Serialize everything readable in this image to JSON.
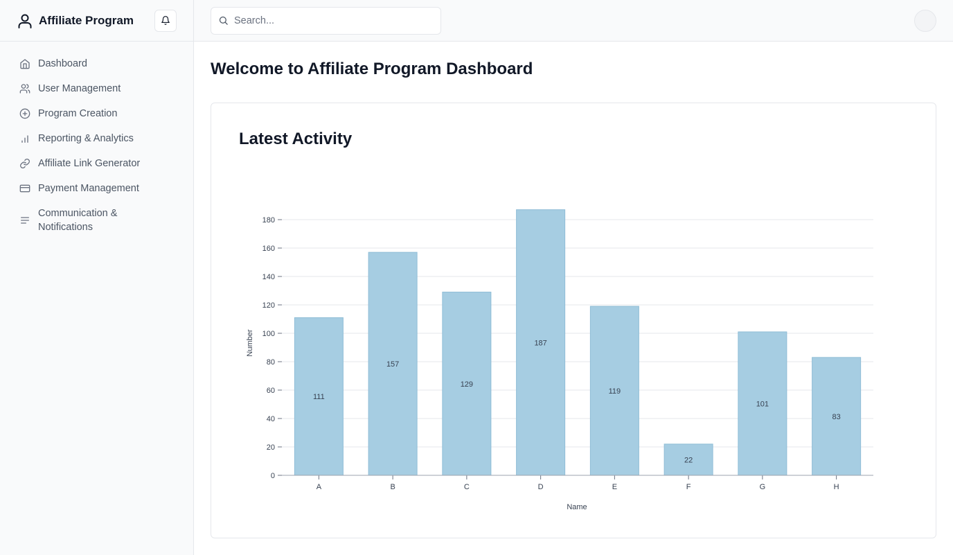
{
  "brand": {
    "title": "Affiliate Program"
  },
  "icons": {
    "user": "user-icon",
    "bell": "bell-icon",
    "search": "search-icon"
  },
  "sidebar": {
    "items": [
      {
        "label": "Dashboard",
        "icon": "home-icon"
      },
      {
        "label": "User Management",
        "icon": "users-icon"
      },
      {
        "label": "Program Creation",
        "icon": "plus-circle-icon"
      },
      {
        "label": "Reporting & Analytics",
        "icon": "bar-chart-icon"
      },
      {
        "label": "Affiliate Link Generator",
        "icon": "link-icon"
      },
      {
        "label": "Payment Management",
        "icon": "credit-card-icon"
      },
      {
        "label": "Communication & Notifications",
        "icon": "menu-lines-icon"
      }
    ]
  },
  "search": {
    "placeholder": "Search..."
  },
  "main": {
    "page_title": "Welcome to Affiliate Program Dashboard",
    "card_title": "Latest Activity"
  },
  "colors": {
    "bar_fill": "#a6cde2",
    "bar_stroke": "#8fbdd6",
    "grid": "#e5e7eb"
  },
  "chart_data": {
    "type": "bar",
    "categories": [
      "A",
      "B",
      "C",
      "D",
      "E",
      "F",
      "G",
      "H"
    ],
    "values": [
      111,
      157,
      129,
      187,
      119,
      22,
      101,
      83
    ],
    "xlabel": "Name",
    "ylabel": "Number",
    "ylim": [
      0,
      180
    ],
    "yticks": [
      0,
      20,
      40,
      60,
      80,
      100,
      120,
      140,
      160,
      180
    ],
    "grid": true,
    "data_labels": true
  }
}
